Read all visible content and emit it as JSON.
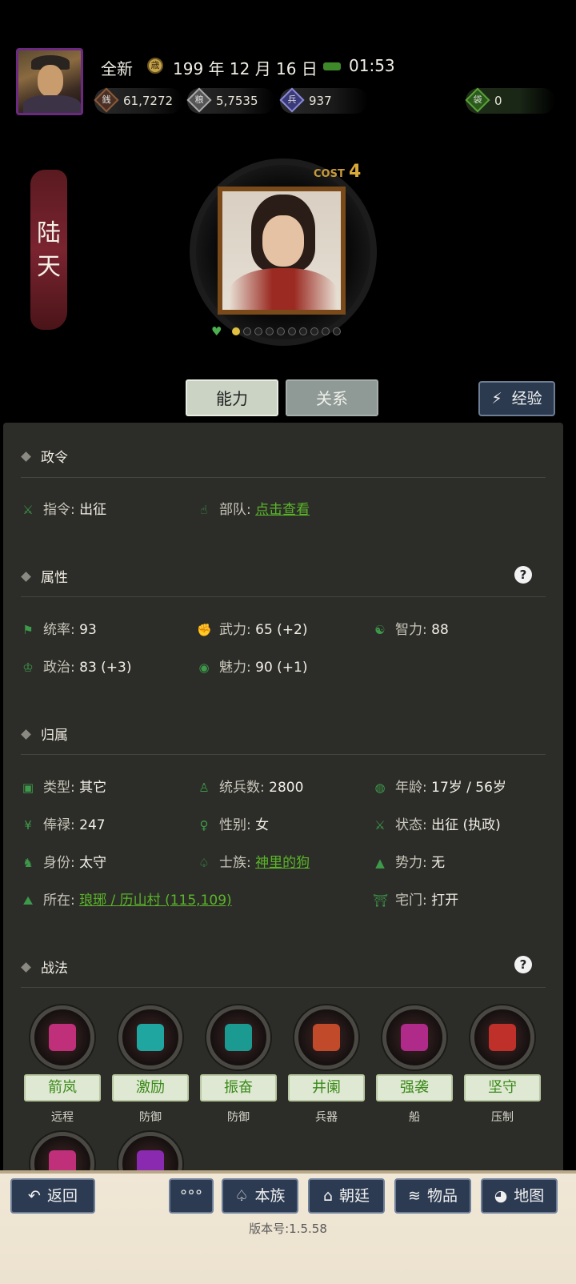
{
  "header": {
    "status": "全新",
    "date": "199 年 12 月 16 日",
    "time": "01:53",
    "resources": [
      {
        "icon": "money-icon",
        "value": "61,7272"
      },
      {
        "icon": "grain-icon",
        "value": "5,7535"
      },
      {
        "icon": "soldier-icon",
        "value": "937"
      },
      {
        "icon": "pouch-icon",
        "value": "0"
      }
    ]
  },
  "hero": {
    "name_chars": [
      "陆",
      "天"
    ],
    "cost_label": "COST",
    "cost_value": "4",
    "star_total": 10,
    "star_filled": 1
  },
  "tabs": {
    "ability": "能力",
    "relation": "关系",
    "exp": "经验"
  },
  "sections": {
    "decree": {
      "title": "政令",
      "items": [
        {
          "label": "指令:",
          "value": "出征"
        },
        {
          "label": "部队:",
          "value": "点击查看"
        }
      ]
    },
    "attributes": {
      "title": "属性",
      "help": "?",
      "items": [
        {
          "label": "统率:",
          "value": "93"
        },
        {
          "label": "武力:",
          "value": "65 (+2)"
        },
        {
          "label": "智力:",
          "value": "88"
        },
        {
          "label": "政治:",
          "value": "83 (+3)"
        },
        {
          "label": "魅力:",
          "value": "90 (+1)"
        }
      ]
    },
    "belong": {
      "title": "归属",
      "items": [
        {
          "label": "类型:",
          "value": "其它"
        },
        {
          "label": "统兵数:",
          "value": "2800"
        },
        {
          "label": "年龄:",
          "value": "17岁 / 56岁"
        },
        {
          "label": "俸禄:",
          "value": "247"
        },
        {
          "label": "性别:",
          "value": "女"
        },
        {
          "label": "状态:",
          "value": "出征 (执政)"
        },
        {
          "label": "身份:",
          "value": "太守"
        },
        {
          "label": "士族:",
          "value": "神里的狗"
        },
        {
          "label": "势力:",
          "value": "无"
        },
        {
          "label": "所在:",
          "value": "琅琊 / 历山村 (115,109)"
        },
        {
          "label": "宅门:",
          "value": "打开"
        }
      ]
    },
    "tactics": {
      "title": "战法",
      "help": "?",
      "skills": [
        {
          "name": "箭岚",
          "type": "远程",
          "color": "#c0307a"
        },
        {
          "name": "激励",
          "type": "防御",
          "color": "#20a6a0"
        },
        {
          "name": "振奋",
          "type": "防御",
          "color": "#1a9a90"
        },
        {
          "name": "井阑",
          "type": "兵器",
          "color": "#c04a2a"
        },
        {
          "name": "强袭",
          "type": "船",
          "color": "#b02a8a"
        },
        {
          "name": "坚守",
          "type": "压制",
          "color": "#c0302a"
        }
      ]
    }
  },
  "bottom_bar": {
    "back": "返回",
    "more": "°°°",
    "clan": "本族",
    "court": "朝廷",
    "items": "物品",
    "map": "地图",
    "version": "版本号:1.5.58"
  }
}
